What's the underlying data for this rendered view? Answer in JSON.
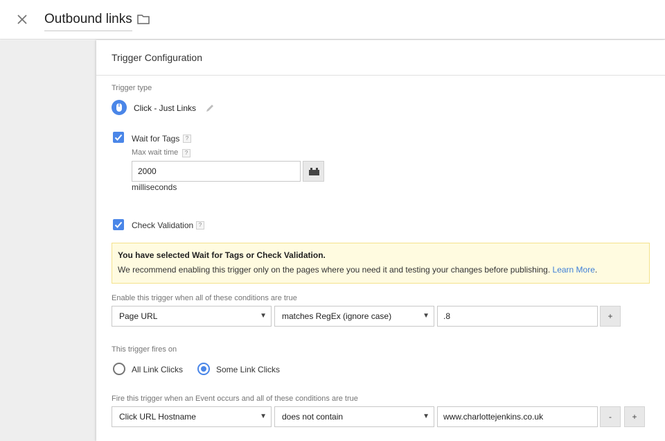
{
  "header": {
    "title": "Outbound links"
  },
  "card": {
    "title": "Trigger Configuration",
    "trigger_type_label": "Trigger type",
    "trigger_type_value": "Click - Just Links",
    "wait_for_tags": {
      "label": "Wait for Tags",
      "help": "?",
      "checked": true,
      "max_wait_label": "Max wait time",
      "max_wait_help": "?",
      "max_wait_value": "2000",
      "unit": "milliseconds"
    },
    "check_validation": {
      "label": "Check Validation",
      "help": "?",
      "checked": true
    },
    "notice": {
      "title": "You have selected Wait for Tags or Check Validation.",
      "text": "We recommend enabling this trigger only on the pages where you need it and testing your changes before publishing.",
      "link": "Learn More",
      "link_suffix": "."
    },
    "enable_conditions": {
      "label": "Enable this trigger when all of these conditions are true",
      "variable": "Page URL",
      "operator": "matches RegEx (ignore case)",
      "value": ".8",
      "add": "+"
    },
    "fires_on": {
      "label": "This trigger fires on",
      "options": [
        "All Link Clicks",
        "Some Link Clicks"
      ],
      "selected": "Some Link Clicks"
    },
    "fire_conditions": {
      "label": "Fire this trigger when an Event occurs and all of these conditions are true",
      "variable": "Click URL Hostname",
      "operator": "does not contain",
      "value": "www.charlottejenkins.co.uk",
      "remove": "-",
      "add": "+"
    }
  },
  "icons": {
    "close": "close-icon",
    "folder": "folder-icon",
    "mouse": "mouse-icon",
    "pencil": "pencil-icon",
    "check": "check-icon",
    "variable": "lego-brick-icon",
    "dropdown": "caret-down-icon"
  },
  "colors": {
    "accent": "#4a86e8",
    "notice_bg": "#fffbe0",
    "notice_border": "#f4e28c",
    "link": "#3f7fd7"
  }
}
